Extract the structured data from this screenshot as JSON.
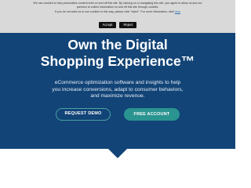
{
  "cookie_banner": {
    "line1": "We use cookies to help personalize content both on and off this site. By clicking on or navigating this site, you agree to allow us and our",
    "line2": "partners to collect information on and off this site through cookies.",
    "line3_text": "If you do not want us to use cookies in this way, please click \"reject\". For more information, click",
    "line3_link": "here",
    "accept_label": "Accept",
    "reject_label": "Reject"
  },
  "hero": {
    "headline_line1": "Own the Digital",
    "headline_line2": "Shopping Experience™",
    "subtext_line1": "eCommerce optimization software and insights to help",
    "subtext_line2": "you increase conversions, adapt to consumer behaviors,",
    "subtext_line3": "and maximize revenue.",
    "request_demo_label": "REQUEST DEMO",
    "free_account_label": "FREE ACCOUNT"
  },
  "colors": {
    "hero_background": "#124477",
    "banner_background": "#d9d9d9",
    "primary_teal": "#2a9490",
    "outline_teal": "#4aa3a2"
  }
}
